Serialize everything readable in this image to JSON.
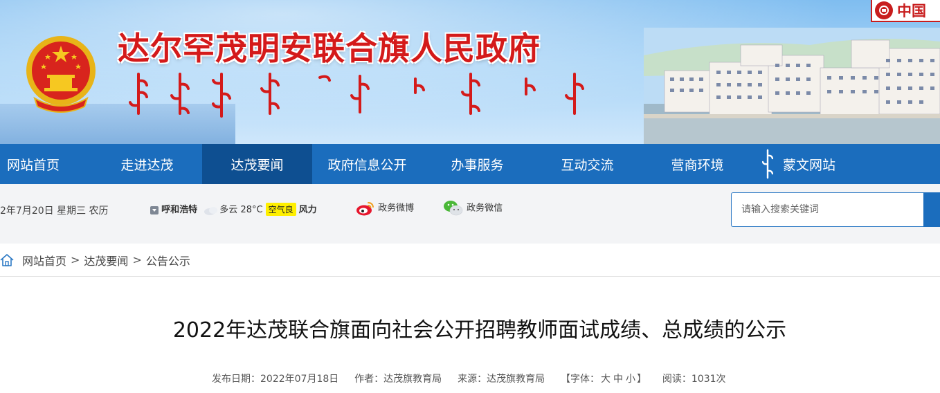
{
  "banner": {
    "title": "达尔罕茂明安联合旗人民政府",
    "badge_text": "中国"
  },
  "nav": {
    "items": [
      {
        "label": "网站首页",
        "active": false
      },
      {
        "label": "走进达茂",
        "active": false
      },
      {
        "label": "达茂要闻",
        "active": true
      },
      {
        "label": "政府信息公开",
        "active": false
      },
      {
        "label": "办事服务",
        "active": false
      },
      {
        "label": "互动交流",
        "active": false
      },
      {
        "label": "营商环境",
        "active": false
      },
      {
        "label": "蒙文网站",
        "active": false
      }
    ]
  },
  "infobar": {
    "date": "2年7月20日 星期三 农历",
    "city": "呼和浩特",
    "weather": "多云",
    "temperature": "28°C",
    "aqi": "空气良",
    "wind": "风力",
    "weibo": "政务微博",
    "wechat": "政务微信",
    "search_placeholder": "请输入搜索关键词"
  },
  "breadcrumb": {
    "items": [
      "网站首页",
      "达茂要闻",
      "公告公示"
    ],
    "separator": ">"
  },
  "article": {
    "title": "2022年达茂联合旗面向社会公开招聘教师面试成绩、总成绩的公示",
    "date_label": "发布日期：",
    "date": "2022年07月18日",
    "author_label": "作者：",
    "author": "达茂旗教育局",
    "source_label": "来源：",
    "source": "达茂旗教育局",
    "font_open": "【字体：",
    "font_large": "大",
    "font_medium": "中",
    "font_small": "小",
    "font_close": "】",
    "reads_label": "阅读：",
    "reads": "1031次"
  },
  "colors": {
    "nav_bg": "#1b6dbd",
    "nav_active": "#0e4f91",
    "title_red": "#d41a1a",
    "aqi_yellow": "#ffef00"
  }
}
